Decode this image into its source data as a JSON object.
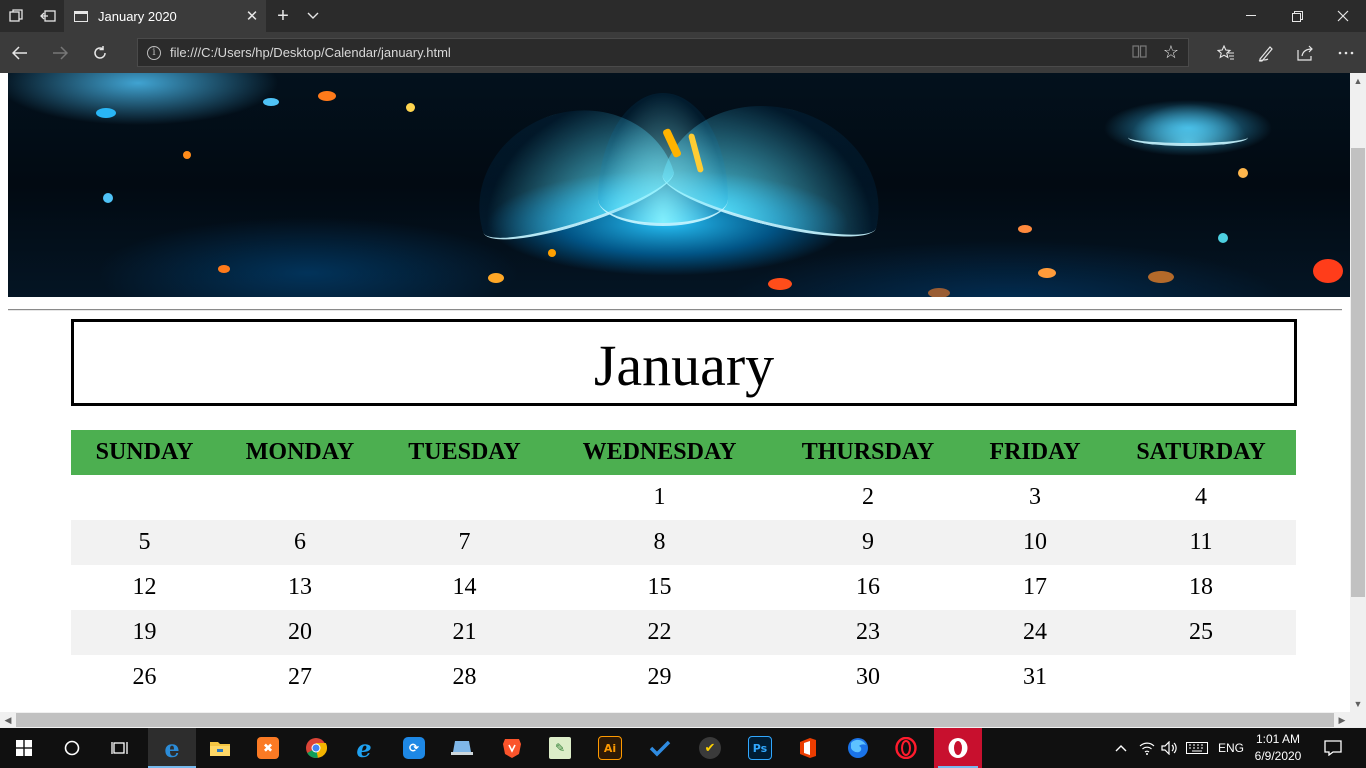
{
  "browser": {
    "tab_title": "January 2020",
    "url": "file:///C:/Users/hp/Desktop/Calendar/january.html"
  },
  "page": {
    "month": "January",
    "days": [
      "SUNDAY",
      "MONDAY",
      "TUESDAY",
      "WEDNESDAY",
      "THURSDAY",
      "FRIDAY",
      "SATURDAY"
    ],
    "weeks": [
      [
        "",
        "",
        "",
        "1",
        "2",
        "3",
        "4"
      ],
      [
        "5",
        "6",
        "7",
        "8",
        "9",
        "10",
        "11"
      ],
      [
        "12",
        "13",
        "14",
        "15",
        "16",
        "17",
        "18"
      ],
      [
        "19",
        "20",
        "21",
        "22",
        "23",
        "24",
        "25"
      ],
      [
        "26",
        "27",
        "28",
        "29",
        "30",
        "31",
        ""
      ]
    ],
    "header_color": "#4caf50",
    "stripe_color": "#f2f2f2"
  },
  "taskbar": {
    "apps": [
      "edge-icon",
      "file-explorer-icon",
      "xampp-icon",
      "chrome-icon",
      "internet-explorer-icon",
      "sync-icon",
      "laptop-icon",
      "brave-icon",
      "notepad-plus-icon",
      "illustrator-icon",
      "todo-icon",
      "norton-icon",
      "photoshop-icon",
      "office-icon",
      "firefox-icon",
      "opera-icon",
      "opera-gx-icon"
    ],
    "language": "ENG",
    "time": "1:01 AM",
    "date": "6/9/2020",
    "illustrator_label": "Ai",
    "photoshop_label": "Ps"
  }
}
